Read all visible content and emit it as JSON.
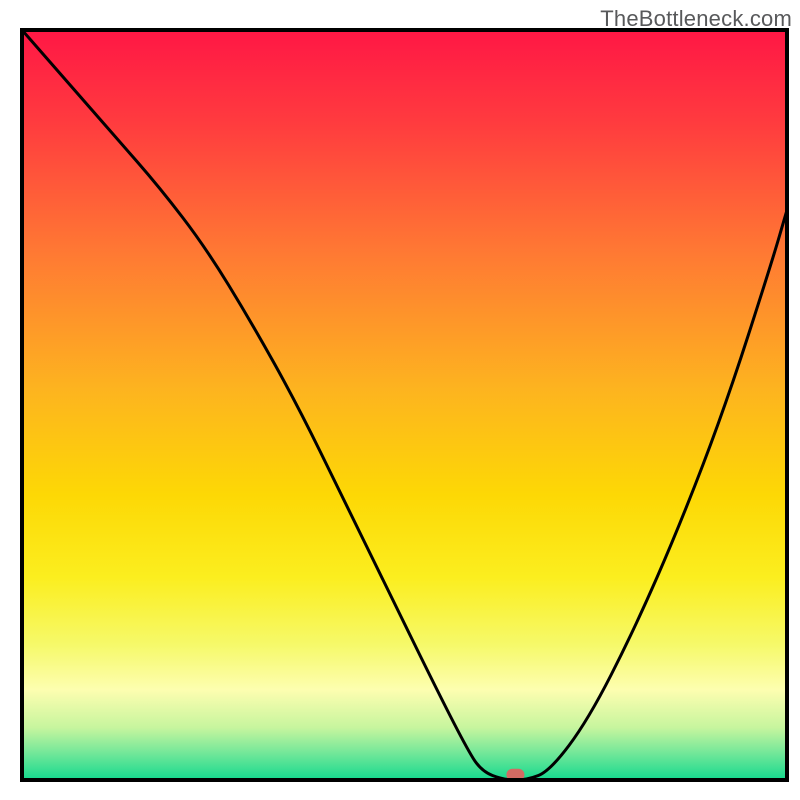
{
  "watermark": "TheBottleneck.com",
  "chart_data": {
    "type": "line",
    "title": "",
    "xlabel": "",
    "ylabel": "",
    "xlim": [
      0,
      100
    ],
    "ylim": [
      0,
      100
    ],
    "grid": false,
    "legend": false,
    "annotations": [],
    "background": {
      "type": "vertical_gradient",
      "stops": [
        {
          "offset": 0.0,
          "color": "#ff1745"
        },
        {
          "offset": 0.12,
          "color": "#ff3a3f"
        },
        {
          "offset": 0.3,
          "color": "#ff7a33"
        },
        {
          "offset": 0.48,
          "color": "#fdb41f"
        },
        {
          "offset": 0.62,
          "color": "#fdd805"
        },
        {
          "offset": 0.73,
          "color": "#fbee1f"
        },
        {
          "offset": 0.82,
          "color": "#f6f96a"
        },
        {
          "offset": 0.88,
          "color": "#fdfeb0"
        },
        {
          "offset": 0.93,
          "color": "#c7f59e"
        },
        {
          "offset": 0.96,
          "color": "#7de99a"
        },
        {
          "offset": 0.985,
          "color": "#3cdf93"
        },
        {
          "offset": 1.0,
          "color": "#13d88e"
        }
      ]
    },
    "series": [
      {
        "name": "bottleneck-curve",
        "x": [
          0,
          6,
          12,
          18,
          24,
          30,
          36,
          42,
          48,
          54,
          58,
          60,
          63,
          66,
          69,
          74,
          80,
          86,
          92,
          98,
          100
        ],
        "y": [
          100,
          93,
          86,
          79,
          71,
          61,
          50,
          37.5,
          25,
          12.5,
          4.5,
          1.2,
          0,
          0,
          1.2,
          8,
          20,
          34,
          50,
          69,
          76
        ]
      }
    ],
    "markers": [
      {
        "name": "min-marker",
        "x": 64.5,
        "y": 0.7,
        "color": "#d36a63",
        "rx": 9,
        "ry": 6
      }
    ],
    "frame_color": "#000000"
  }
}
